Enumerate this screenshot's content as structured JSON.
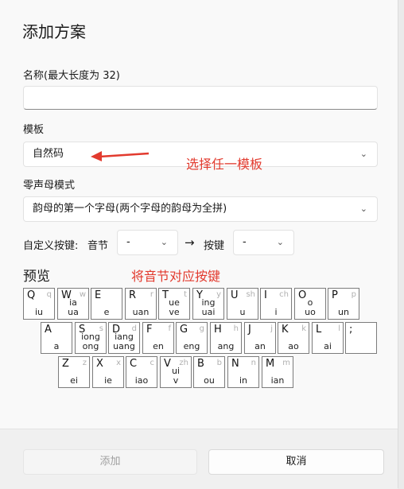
{
  "dialog": {
    "title": "添加方案",
    "name_label": "名称(最大长度为 32)",
    "name_value": "",
    "template_label": "模板",
    "template_value": "自然码",
    "zero_label": "零声母模式",
    "zero_value": "韵母的第一个字母(两个字母的韵母为全拼)",
    "custom_label": "自定义按键:",
    "syllable_label": "音节",
    "syllable_value": "-",
    "arrow_symbol": "→",
    "key_label": "按键",
    "key_value": "-",
    "preview_label": "预览"
  },
  "annotations": {
    "template_hint": "选择任一模板",
    "mapping_hint": "将音节对应按键"
  },
  "keyboard": {
    "row1": [
      {
        "letter": "Q",
        "small": "q",
        "final": "iu"
      },
      {
        "letter": "W",
        "small": "w",
        "final": "ia\nua"
      },
      {
        "letter": "E",
        "small": "",
        "final": "e"
      },
      {
        "letter": "R",
        "small": "r",
        "final": "uan"
      },
      {
        "letter": "T",
        "small": "t",
        "final": "ue\nve"
      },
      {
        "letter": "Y",
        "small": "y",
        "final": "ing\nuai"
      },
      {
        "letter": "U",
        "small": "sh",
        "final": "u"
      },
      {
        "letter": "I",
        "small": "ch",
        "final": "i"
      },
      {
        "letter": "O",
        "small": "",
        "final": "o\nuo"
      },
      {
        "letter": "P",
        "small": "p",
        "final": "un"
      }
    ],
    "row2": [
      {
        "letter": "A",
        "small": "",
        "final": "a"
      },
      {
        "letter": "S",
        "small": "s",
        "final": "iong\nong"
      },
      {
        "letter": "D",
        "small": "d",
        "final": "iang\nuang"
      },
      {
        "letter": "F",
        "small": "f",
        "final": "en"
      },
      {
        "letter": "G",
        "small": "g",
        "final": "eng"
      },
      {
        "letter": "H",
        "small": "h",
        "final": "ang"
      },
      {
        "letter": "J",
        "small": "j",
        "final": "an"
      },
      {
        "letter": "K",
        "small": "k",
        "final": "ao"
      },
      {
        "letter": "L",
        "small": "l",
        "final": "ai"
      },
      {
        "letter": ";",
        "small": "",
        "final": ""
      }
    ],
    "row3": [
      {
        "letter": "Z",
        "small": "z",
        "final": "ei"
      },
      {
        "letter": "X",
        "small": "x",
        "final": "ie"
      },
      {
        "letter": "C",
        "small": "c",
        "final": "iao"
      },
      {
        "letter": "V",
        "small": "zh",
        "final": "ui\nv"
      },
      {
        "letter": "B",
        "small": "b",
        "final": "ou"
      },
      {
        "letter": "N",
        "small": "n",
        "final": "in"
      },
      {
        "letter": "M",
        "small": "m",
        "final": "ian"
      }
    ]
  },
  "footer": {
    "add_label": "添加",
    "cancel_label": "取消"
  },
  "colors": {
    "annotation": "#e23a2e",
    "accent_disabled": "#bdbdbd"
  }
}
